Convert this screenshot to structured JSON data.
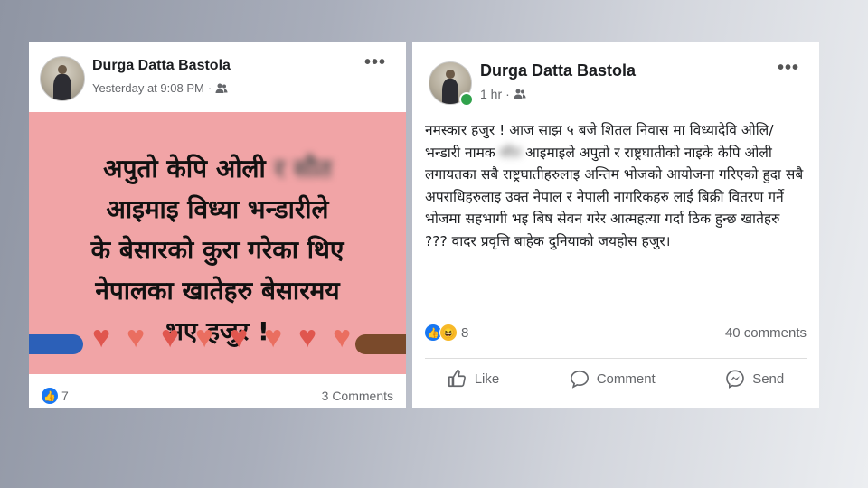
{
  "left_post": {
    "author": "Durga Datta Bastola",
    "timestamp": "Yesterday at 9:08 PM",
    "audience_icon": "friends-icon",
    "banner_lines": [
      {
        "pre": "अपुतो केपि ओली ",
        "blurred": "र सौत"
      },
      {
        "pre": "आइमाइ विध्या भन्डारीले",
        "blurred": ""
      },
      {
        "pre": "के बेसारको कुरा गरेका थिए",
        "blurred": ""
      },
      {
        "pre": "नेपालका खातेहरु बेसारमय",
        "blurred": ""
      },
      {
        "pre": "भए हजुर !",
        "blurred": ""
      }
    ],
    "banner_color": "#f1a4a6",
    "reaction_count": "7",
    "comments": "3 Comments"
  },
  "right_post": {
    "author": "Durga Datta Bastola",
    "timestamp": "1 hr",
    "audience_icon": "friends-icon",
    "text_part1": "नमस्कार हजुर ! आज साझ ५ बजे शितल निवास मा विध्यादेवि ओलि/ भन्डारी नामक ",
    "text_blurred": "सौत",
    "text_part2": " आइमाइले अपुतो र राष्ट्रघातीको नाइके केपि ओली लगायतका सबै राष्ट्रघातीहरुलाइ अन्तिम भोजको आयोजना गरिएको हुदा सबै अपराधिहरुलाइ उक्त नेपाल र नेपाली नागरिकहरु लाई बिक्री वितरण गर्ने भोजमा सहभागी भइ बिष सेवन गरेर आत्महत्या गर्दा ठिक हुन्छ खातेहरु ??? वादर प्रवृत्ति बाहेक दुनियाको जयहोस हजुर।",
    "reaction_count": "8",
    "comments": "40 comments",
    "actions": {
      "like": "Like",
      "comment": "Comment",
      "send": "Send"
    }
  },
  "colors": {
    "accent": "#1877f2",
    "online": "#31a24c",
    "heart": "#e0564e"
  }
}
